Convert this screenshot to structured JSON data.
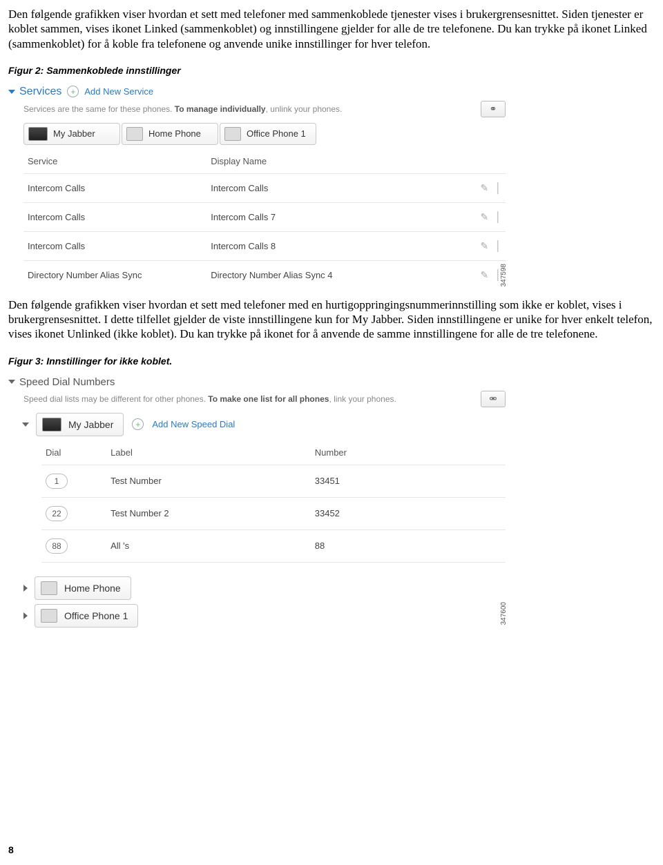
{
  "intro1": "Den følgende grafikken viser hvordan et sett med telefoner med sammenkoblede tjenester vises i brukergrensesnittet. Siden tjenester er koblet sammen, vises ikonet Linked (sammenkoblet) og innstillingene gjelder for alle de tre telefonene. Du kan trykke på ikonet Linked (sammenkoblet) for å koble fra telefonene og anvende unike innstillinger for hver telefon.",
  "fig2_caption": "Figur 2: Sammenkoblede innstillinger",
  "fig2": {
    "header": "Services",
    "add_link": "Add New Service",
    "note_a": "Services are the same for these phones. ",
    "note_b": "To manage individually",
    "note_c": ", unlink your phones.",
    "tabs": [
      "My Jabber",
      "Home Phone",
      "Office Phone 1"
    ],
    "col_service": "Service",
    "col_display": "Display Name",
    "rows": [
      {
        "s": "Intercom Calls",
        "d": "Intercom Calls"
      },
      {
        "s": "Intercom Calls",
        "d": "Intercom Calls 7"
      },
      {
        "s": "Intercom Calls",
        "d": "Intercom Calls 8"
      },
      {
        "s": "Directory Number Alias Sync",
        "d": "Directory Number Alias Sync 4"
      }
    ],
    "imgnum": "347598"
  },
  "intro2": "Den følgende grafikken viser hvordan et sett med telefoner med en hurtigoppringingsnummerinnstilling som ikke er koblet, vises i brukergrensesnittet. I dette tilfellet gjelder de viste innstillingene kun for My Jabber. Siden innstillingene er unike for hver enkelt telefon, vises ikonet Unlinked (ikke koblet). Du kan trykke på ikonet for å anvende de samme innstillingene for alle de tre telefonene.",
  "fig3_caption": "Figur 3: Innstillinger for ikke koblet.",
  "fig3": {
    "header": "Speed Dial Numbers",
    "note_a": "Speed dial lists may be different for other phones. ",
    "note_b": "To make one list for all phones",
    "note_c": ", link your phones.",
    "device": "My Jabber",
    "add_link": "Add New Speed Dial",
    "col_dial": "Dial",
    "col_label": "Label",
    "col_number": "Number",
    "rows": [
      {
        "dial": "1",
        "label": "Test Number",
        "number": "33451"
      },
      {
        "dial": "22",
        "label": "Test Number 2",
        "number": "33452"
      },
      {
        "dial": "88",
        "label": "All 's",
        "number": "88"
      }
    ],
    "collapsed": [
      "Home Phone",
      "Office Phone 1"
    ],
    "imgnum": "347600"
  },
  "page": "8"
}
